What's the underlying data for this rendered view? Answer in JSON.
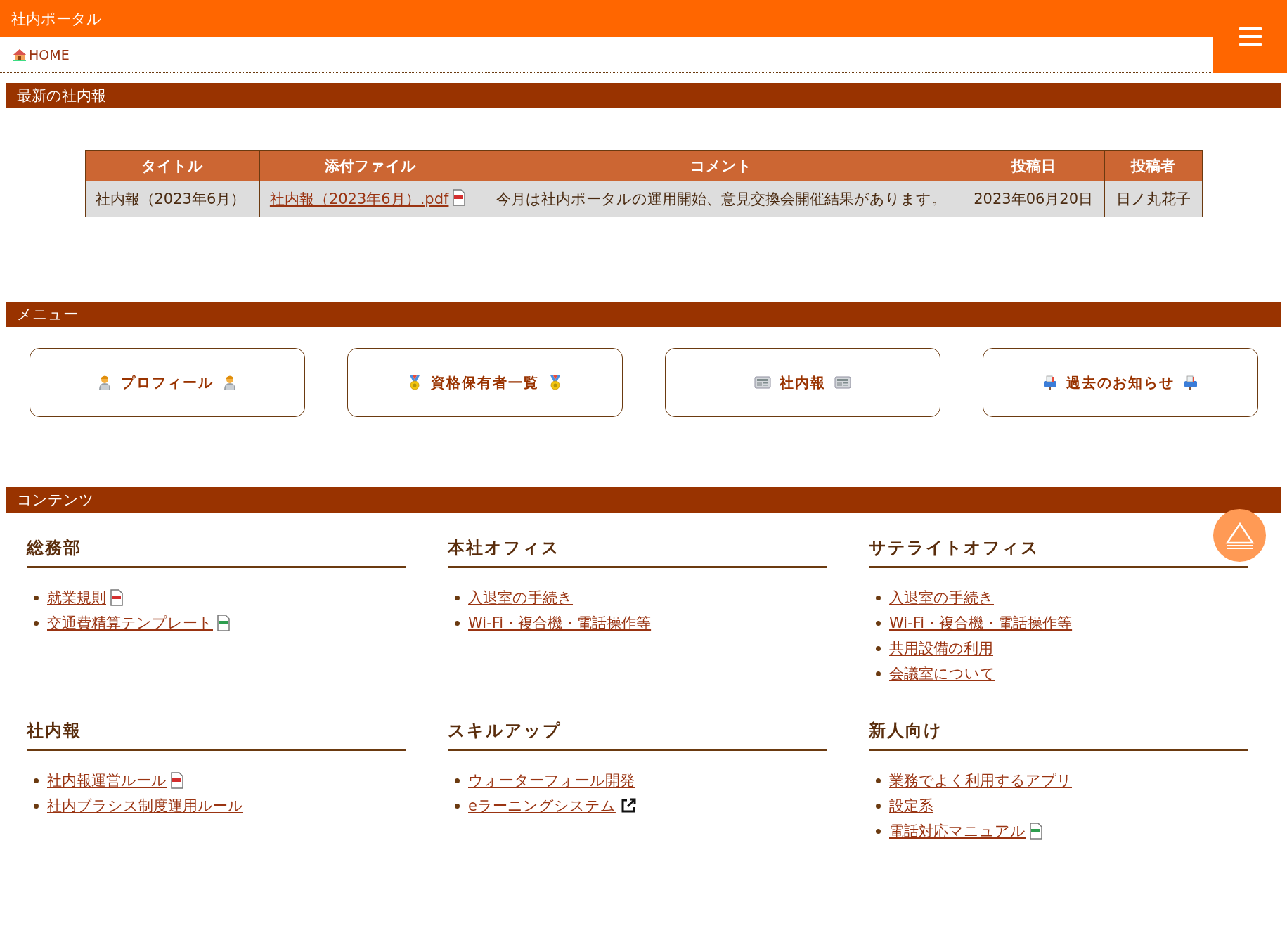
{
  "header": {
    "title": "社内ポータル"
  },
  "breadcrumb": {
    "label": "HOME"
  },
  "latest": {
    "heading": "最新の社内報",
    "columns": [
      "タイトル",
      "添付ファイル",
      "コメント",
      "投稿日",
      "投稿者"
    ],
    "rows": [
      {
        "title": "社内報（2023年6月）",
        "file": {
          "label": "社内報（2023年6月）.pdf",
          "kind": "pdf"
        },
        "comment": "今月は社内ポータルの運用開始、意見交換会開催結果があります。",
        "date": "2023年06月20日",
        "author": "日ノ丸花子"
      }
    ]
  },
  "menu": {
    "heading": "メニュー",
    "buttons": [
      {
        "label": "プロフィール",
        "kind": "worker"
      },
      {
        "label": "資格保有者一覧",
        "kind": "medal"
      },
      {
        "label": "社内報",
        "kind": "newspaper"
      },
      {
        "label": "過去のお知らせ",
        "kind": "mailbox"
      }
    ]
  },
  "contents": {
    "heading": "コンテンツ",
    "sections": [
      {
        "title": "総務部",
        "links": [
          {
            "label": "就業規則",
            "kind": "pdf"
          },
          {
            "label": "交通費精算テンプレート",
            "kind": "xls"
          }
        ]
      },
      {
        "title": "本社オフィス",
        "links": [
          {
            "label": "入退室の手続き",
            "kind": "plain"
          },
          {
            "label": "Wi-Fi・複合機・電話操作等",
            "kind": "plain"
          }
        ]
      },
      {
        "title": "サテライトオフィス",
        "links": [
          {
            "label": "入退室の手続き",
            "kind": "plain"
          },
          {
            "label": "Wi-Fi・複合機・電話操作等",
            "kind": "plain"
          },
          {
            "label": "共用設備の利用",
            "kind": "plain"
          },
          {
            "label": "会議室について",
            "kind": "plain"
          }
        ]
      },
      {
        "title": "社内報",
        "links": [
          {
            "label": "社内報運営ルール",
            "kind": "pdf"
          },
          {
            "label": "社内ブラシス制度運用ルール",
            "kind": "plain"
          }
        ]
      },
      {
        "title": "スキルアップ",
        "links": [
          {
            "label": "ウォーターフォール開発",
            "kind": "plain"
          },
          {
            "label": "eラーニングシステム",
            "kind": "external"
          }
        ]
      },
      {
        "title": "新人向け",
        "links": [
          {
            "label": "業務でよく利用するアプリ",
            "kind": "plain"
          },
          {
            "label": "設定系",
            "kind": "plain"
          },
          {
            "label": "電話対応マニュアル",
            "kind": "xls"
          }
        ]
      }
    ]
  }
}
